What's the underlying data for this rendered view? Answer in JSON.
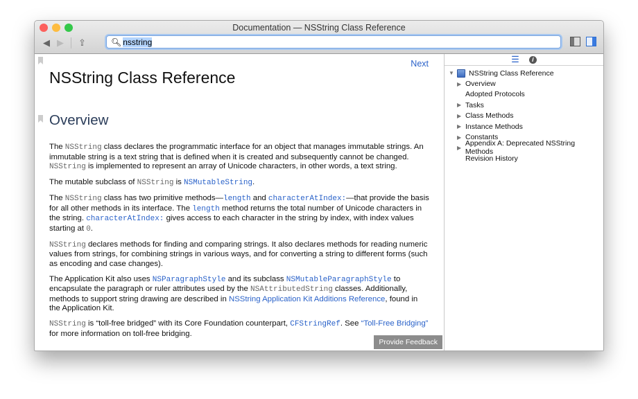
{
  "window": {
    "title": "Documentation — NSString Class Reference"
  },
  "toolbar": {
    "back": "◀",
    "forward": "▶",
    "share": "⇪",
    "search_value": "nsstring",
    "search_icon": "magnifier-icon"
  },
  "main": {
    "next": "Next",
    "title": "NSString Class Reference",
    "section": "Overview",
    "feedback": "Provide Feedback",
    "paragraphs": [
      [
        {
          "t": "The "
        },
        {
          "t": "NSString",
          "k": "code"
        },
        {
          "t": " class declares the programmatic interface for an object that manages immutable strings. An immutable string is a text string that is defined when it is created and subsequently cannot be changed. "
        },
        {
          "t": "NSString",
          "k": "code"
        },
        {
          "t": " is implemented to represent an array of Unicode characters, in other words, a text string."
        }
      ],
      [
        {
          "t": "The mutable subclass of "
        },
        {
          "t": "NSString",
          "k": "code"
        },
        {
          "t": " is "
        },
        {
          "t": "NSMutableString",
          "k": "codelink"
        },
        {
          "t": "."
        }
      ],
      [
        {
          "t": "The "
        },
        {
          "t": "NSString",
          "k": "code"
        },
        {
          "t": " class has two primitive methods—"
        },
        {
          "t": "length",
          "k": "codelink"
        },
        {
          "t": " and "
        },
        {
          "t": "characterAtIndex:",
          "k": "codelink"
        },
        {
          "t": "—that provide the basis for all other methods in its interface. The "
        },
        {
          "t": "length",
          "k": "codelink"
        },
        {
          "t": " method returns the total number of Unicode characters in the string. "
        },
        {
          "t": "characterAtIndex:",
          "k": "codelink"
        },
        {
          "t": " gives access to each character in the string by index, with index values starting at "
        },
        {
          "t": "0",
          "k": "code"
        },
        {
          "t": "."
        }
      ],
      [
        {
          "t": "NSString",
          "k": "code"
        },
        {
          "t": " declares methods for finding and comparing strings. It also declares methods for reading numeric values from strings, for combining strings in various ways, and for converting a string to different forms (such as encoding and case changes)."
        }
      ],
      [
        {
          "t": "The Application Kit also uses "
        },
        {
          "t": "NSParagraphStyle",
          "k": "codelink"
        },
        {
          "t": " and its subclass "
        },
        {
          "t": "NSMutableParagraphStyle",
          "k": "codelink"
        },
        {
          "t": " to encapsulate the paragraph or ruler attributes used by the "
        },
        {
          "t": "NSAttributedString",
          "k": "code"
        },
        {
          "t": " classes. Additionally, methods to support string drawing are described in "
        },
        {
          "t": "NSString Application Kit Additions Reference",
          "k": "link"
        },
        {
          "t": ", found in the Application Kit."
        }
      ],
      [
        {
          "t": "NSString",
          "k": "code"
        },
        {
          "t": " is “toll-free bridged” with its Core Foundation counterpart, "
        },
        {
          "t": "CFStringRef",
          "k": "codelink"
        },
        {
          "t": ". See "
        },
        {
          "t": "“Toll-Free Bridging”",
          "k": "link"
        },
        {
          "t": " for more information on toll-free bridging."
        }
      ]
    ]
  },
  "sidebar": {
    "tabs": [
      "list-icon",
      "info-icon"
    ],
    "root": "NSString Class Reference",
    "items": [
      {
        "label": "Overview",
        "expandable": true
      },
      {
        "label": "Adopted Protocols",
        "expandable": false
      },
      {
        "label": "Tasks",
        "expandable": true
      },
      {
        "label": "Class Methods",
        "expandable": true
      },
      {
        "label": "Instance Methods",
        "expandable": true
      },
      {
        "label": "Constants",
        "expandable": true
      },
      {
        "label": "Appendix A: Deprecated NSString Methods",
        "expandable": true
      },
      {
        "label": "Revision History",
        "expandable": false
      }
    ]
  },
  "colors": {
    "accent": "#2a62c9",
    "close": "#fc605c",
    "minimize": "#fdbc40",
    "zoom": "#34c84a"
  }
}
